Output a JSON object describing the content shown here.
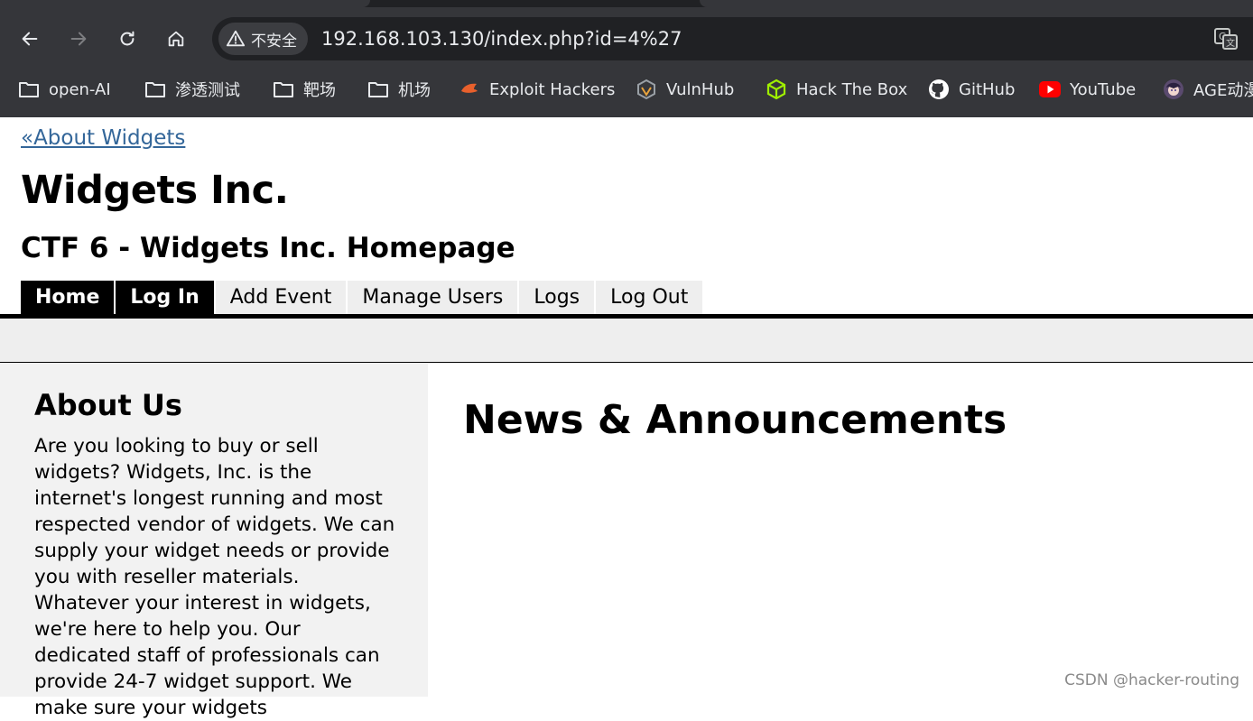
{
  "browser": {
    "security_label": "不安全",
    "url": "192.168.103.130/index.php?id=4%27",
    "bookmarks": [
      {
        "label": "open-AI",
        "icon": "folder-icon"
      },
      {
        "label": "渗透测试",
        "icon": "folder-icon"
      },
      {
        "label": "靶场",
        "icon": "folder-icon"
      },
      {
        "label": "机场",
        "icon": "folder-icon"
      },
      {
        "label": "Exploit Hackers",
        "icon": "exploit-hackers-icon"
      },
      {
        "label": "VulnHub",
        "icon": "vulnhub-icon"
      },
      {
        "label": "Hack The Box",
        "icon": "hackthebox-icon"
      },
      {
        "label": "GitHub",
        "icon": "github-icon"
      },
      {
        "label": "YouTube",
        "icon": "youtube-icon"
      },
      {
        "label": "AGE动漫",
        "icon": "age-anime-icon"
      }
    ]
  },
  "page": {
    "back_link": "«About Widgets",
    "title": "Widgets Inc.",
    "subtitle": "CTF 6 - Widgets Inc. Homepage",
    "nav": [
      "Home",
      "Log In",
      "Add Event",
      "Manage Users",
      "Logs",
      "Log Out"
    ],
    "sidebar": {
      "heading": "About Us",
      "text": "Are you looking to buy or sell widgets? Widgets, Inc. is the internet's longest running and most respected vendor of widgets. We can supply your widget needs or provide you with reseller materials. Whatever your interest in widgets, we're here to help you. Our dedicated staff of professionals can provide 24-7 widget support. We make sure your widgets"
    },
    "main_heading": "News & Announcements"
  },
  "watermark": "CSDN @hacker-routing",
  "colors": {
    "chrome_bg": "#35363a",
    "omnibox_bg": "#202124",
    "link": "#336699",
    "nav_active_bg": "#000000",
    "nav_bg": "#eeeeee",
    "sidebar_bg": "#f2f2f2"
  }
}
